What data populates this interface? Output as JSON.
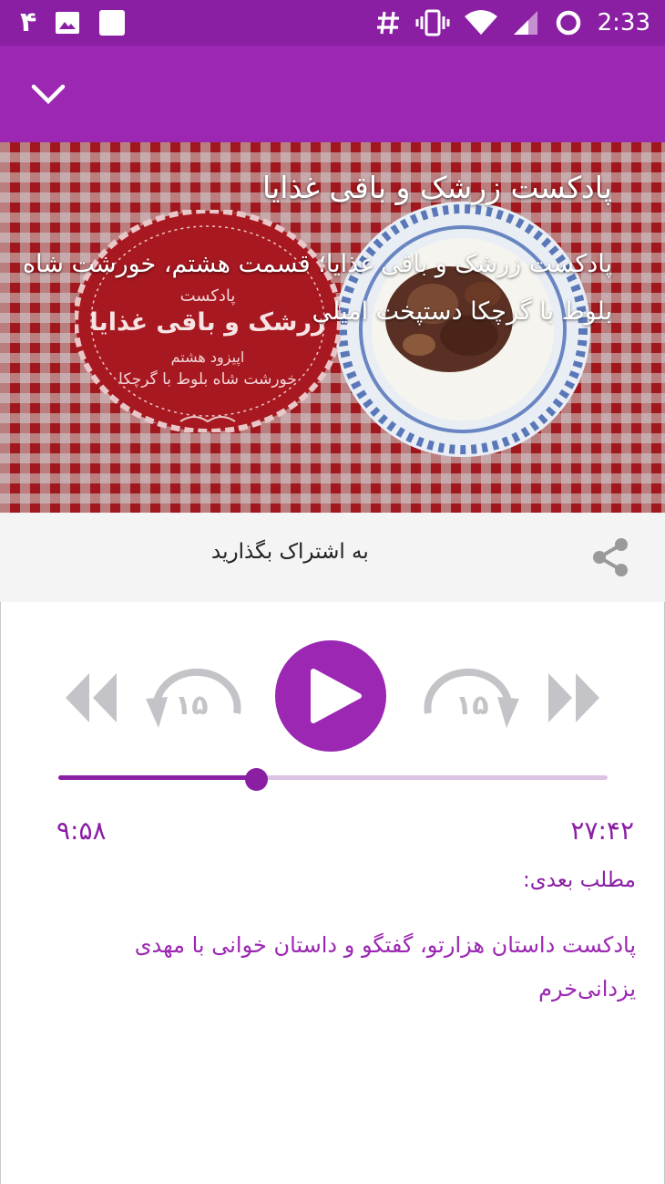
{
  "status_bar": {
    "notification_count": "۴",
    "time": "2:33",
    "icons": [
      "count-badge-icon",
      "image-icon",
      "square-app-icon",
      "hash-icon",
      "vibrate-icon",
      "wifi-icon",
      "signal-icon",
      "loading-circle-icon"
    ]
  },
  "app_bar": {
    "collapse_icon": "chevron-down-icon"
  },
  "hero": {
    "title": "پادکست زرشک و باقی غذایا",
    "subtitle": "پادکست زرشک و باقی غذایا؛ قسمت هشتم، خورشت شاه بلوط با گرچکا دستپخت امیلی",
    "badge": {
      "line1": "پادکست",
      "line2": "زرشک و باقی غذایا",
      "line3": "اپیزود هشتم",
      "line4": "خورشت شاه بلوط با گرچکا"
    }
  },
  "share": {
    "label": "به اشتراک بگذارید",
    "icon": "share-icon"
  },
  "player": {
    "skip_seconds": "۱۵",
    "progress": 0.36,
    "elapsed": "۹:۵۸",
    "total": "۲۷:۴۲",
    "next_label": "مطلب بعدی:",
    "next_title": "پادکست داستان هزارتو، گفتگو و داستان خوانی با مهدی یزدانی‌خرم"
  },
  "colors": {
    "status_bar": "#8a1fa4",
    "app_bar": "#9b27b2",
    "accent": "#9b27b2",
    "control_gray": "#c4c4c8",
    "share_bar": "#f4f4f4"
  }
}
